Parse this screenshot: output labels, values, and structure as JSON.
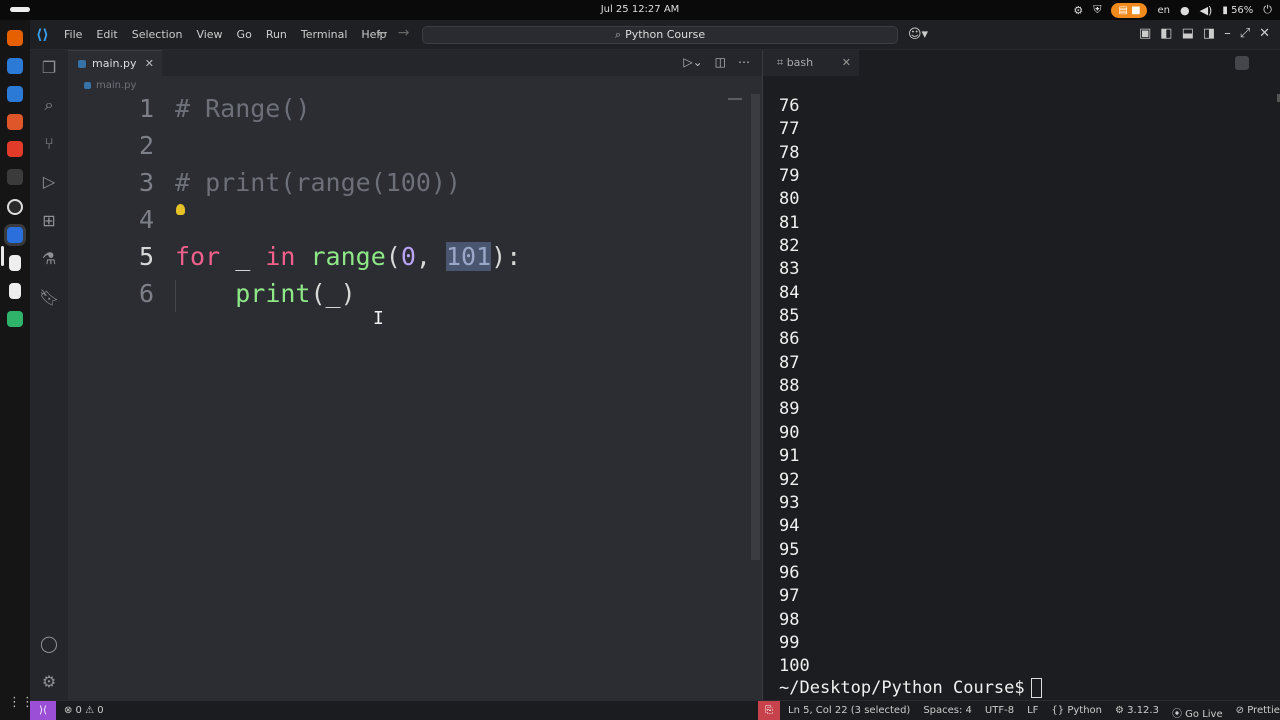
{
  "system": {
    "clock": "Jul 25  12:27 AM",
    "language": "en",
    "battery": "56%",
    "indicator_icons": [
      "settings-icon",
      "shield-icon",
      "keyboard-icon",
      "mic-icon",
      "volume-icon",
      "battery-icon"
    ]
  },
  "dock": {
    "icons": [
      "firefox",
      "files",
      "text-editor",
      "app-store",
      "brave",
      "terminal",
      "obs",
      "vscode",
      "document",
      "document",
      "calculator"
    ],
    "colors": {
      "firefox": "#e66000",
      "files": "#2b7bd6",
      "text-editor": "#2b7bd6",
      "app-store": "#e0562b",
      "brave": "#e23b2a",
      "terminal": "#3b3b3b",
      "obs": "#2a2a2a",
      "vscode": "#2a6fdb",
      "document": "#eeeeee",
      "calculator": "#2fb36b"
    }
  },
  "titlebar": {
    "menu": [
      "File",
      "Edit",
      "Selection",
      "View",
      "Go",
      "Run",
      "Terminal",
      "Help"
    ],
    "command_center": "Python Course"
  },
  "editor": {
    "tab_label": "main.py",
    "breadcrumb": "main.py",
    "lines": [
      {
        "number": "1",
        "tokens": [
          {
            "t": "# Range()",
            "c": "cmt"
          }
        ]
      },
      {
        "number": "2",
        "tokens": []
      },
      {
        "number": "3",
        "tokens": [
          {
            "t": "# print(range(100))",
            "c": "cmt"
          }
        ]
      },
      {
        "number": "4",
        "tokens": []
      },
      {
        "number": "5",
        "tokens": [
          {
            "t": "for",
            "c": "kw"
          },
          {
            "t": " _ ",
            "c": "plain"
          },
          {
            "t": "in",
            "c": "kw"
          },
          {
            "t": " ",
            "c": "plain"
          },
          {
            "t": "range",
            "c": "fn"
          },
          {
            "t": "(",
            "c": "plain"
          },
          {
            "t": "0",
            "c": "num"
          },
          {
            "t": ", ",
            "c": "plain"
          },
          {
            "t": "101",
            "c": "sel"
          },
          {
            "t": "):",
            "c": "plain"
          }
        ]
      },
      {
        "number": "6",
        "tokens": [
          {
            "t": "    ",
            "c": "plain"
          },
          {
            "t": "print",
            "c": "fn"
          },
          {
            "t": "(_)",
            "c": "plain"
          }
        ]
      }
    ],
    "current_line": "5"
  },
  "terminal": {
    "tab_label": "bash",
    "output": [
      "76",
      "77",
      "78",
      "79",
      "80",
      "81",
      "82",
      "83",
      "84",
      "85",
      "86",
      "87",
      "88",
      "89",
      "90",
      "91",
      "92",
      "93",
      "94",
      "95",
      "96",
      "97",
      "98",
      "99",
      "100"
    ],
    "prompt": "~/Desktop/Python Course$"
  },
  "statusbar": {
    "problems": "⊗ 0 ⚠ 0",
    "position": "Ln 5, Col 22 (3 selected)",
    "spaces": "Spaces: 4",
    "encoding": "UTF-8",
    "eol": "LF",
    "language": "Python",
    "python_version": "3.12.3",
    "go_live": "Go Live",
    "prettier": "Prettier"
  }
}
